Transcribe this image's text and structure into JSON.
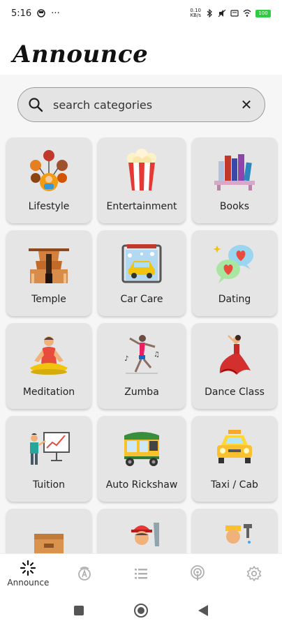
{
  "status_bar": {
    "time": "5:16",
    "dots": "···",
    "network_speed": "0.10\nKB/s",
    "battery": "100"
  },
  "header": {
    "title": "Announce"
  },
  "search": {
    "placeholder": "search categories"
  },
  "categories": [
    {
      "label": "Lifestyle",
      "icon": "lifestyle-icon"
    },
    {
      "label": "Entertainment",
      "icon": "popcorn-icon"
    },
    {
      "label": "Books",
      "icon": "books-icon"
    },
    {
      "label": "Temple",
      "icon": "temple-icon"
    },
    {
      "label": "Car Care",
      "icon": "car-wash-icon"
    },
    {
      "label": "Dating",
      "icon": "hearts-chat-icon"
    },
    {
      "label": "Meditation",
      "icon": "meditation-icon"
    },
    {
      "label": "Zumba",
      "icon": "zumba-dancer-icon"
    },
    {
      "label": "Dance Class",
      "icon": "flamenco-dancer-icon"
    },
    {
      "label": "Tuition",
      "icon": "teacher-board-icon"
    },
    {
      "label": "Auto Rickshaw",
      "icon": "auto-rickshaw-icon"
    },
    {
      "label": "Taxi / Cab",
      "icon": "taxi-icon"
    },
    {
      "label": "",
      "icon": "box-icon"
    },
    {
      "label": "",
      "icon": "worker-saw-icon"
    },
    {
      "label": "",
      "icon": "plumber-icon"
    }
  ],
  "bottom_nav": [
    {
      "label": "Announce",
      "icon": "announce-icon",
      "active": true
    },
    {
      "label": "",
      "icon": "autorickshaw-badge-icon"
    },
    {
      "label": "",
      "icon": "list-icon"
    },
    {
      "label": "",
      "icon": "podcast-icon"
    },
    {
      "label": "",
      "icon": "gear-icon"
    }
  ],
  "colors": {
    "card_bg": "#e5e5e5",
    "search_bg": "#e4e4e4",
    "content_bg": "#f6f6f6",
    "battery": "#2ecc40"
  }
}
